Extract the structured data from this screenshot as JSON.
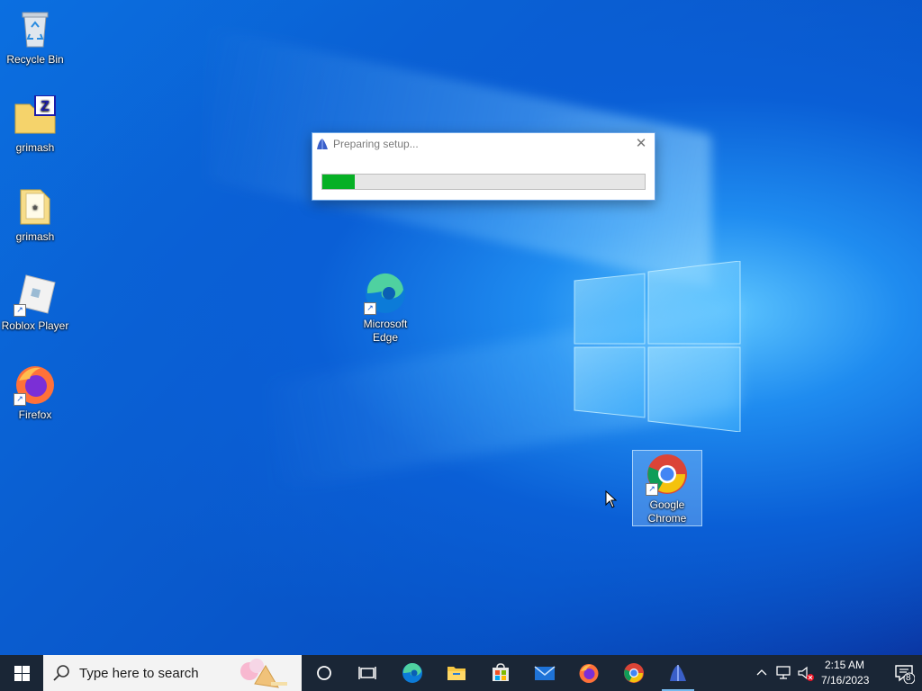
{
  "desktop": {
    "icons": [
      {
        "label": "Recycle Bin",
        "icon": "recycle-bin-icon"
      },
      {
        "label": "grimash",
        "icon": "winzip-folder-icon"
      },
      {
        "label": "grimash",
        "icon": "document-folder-icon"
      },
      {
        "label": "Roblox Player",
        "icon": "roblox-icon"
      },
      {
        "label": "Firefox",
        "icon": "firefox-icon"
      },
      {
        "label": "Microsoft Edge",
        "icon": "edge-icon"
      },
      {
        "label": "Google Chrome",
        "icon": "chrome-icon"
      }
    ]
  },
  "dialog": {
    "title": "Preparing setup...",
    "close_glyph": "✕",
    "progress_fraction": 0.1
  },
  "taskbar": {
    "search_placeholder": "Type here to search",
    "pinned": [
      "cortana-icon",
      "task-view-icon",
      "edge-icon",
      "file-explorer-icon",
      "store-icon",
      "mail-icon",
      "firefox-icon",
      "chrome-icon",
      "setup-icon"
    ],
    "clock_time": "2:15 AM",
    "clock_date": "7/16/2023",
    "notification_count": "8"
  },
  "colors": {
    "taskbar": "#1a2636",
    "progress": "#06b025",
    "accent": "#76b9ed"
  }
}
